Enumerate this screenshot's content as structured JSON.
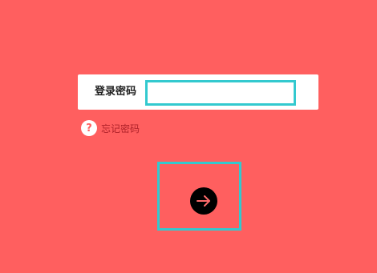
{
  "login": {
    "label": "登录密码",
    "password_value": "",
    "password_placeholder": ""
  },
  "forgot": {
    "icon_glyph": "?",
    "label": "忘记密码"
  },
  "submit": {
    "icon": "arrow-right-icon"
  },
  "colors": {
    "background": "#ff5f5f",
    "input_border": "#33c9cf",
    "forgot_text": "#b0222a",
    "button": "#000000",
    "arrow": "#ff6b6b"
  }
}
